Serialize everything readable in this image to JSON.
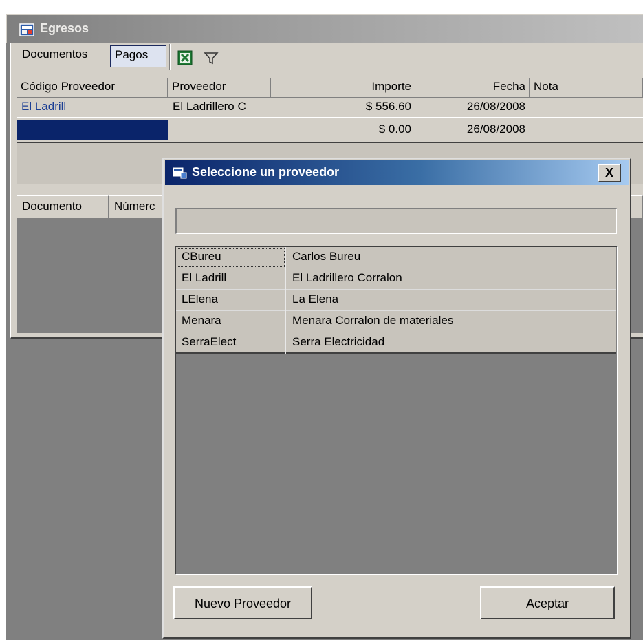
{
  "window": {
    "title": "Egresos"
  },
  "toolbar": {
    "tabs": [
      "Documentos",
      "Pagos"
    ],
    "active_tab": "Pagos",
    "icons": [
      "excel-export-icon",
      "filter-icon"
    ]
  },
  "payments_grid": {
    "columns": [
      "Código Proveedor",
      "Proveedor",
      "Importe",
      "Fecha",
      "Nota"
    ],
    "rows": [
      {
        "codigo": "El Ladrill",
        "proveedor": "El Ladrillero C",
        "importe": "$ 556.60",
        "fecha": "26/08/2008",
        "nota": ""
      },
      {
        "codigo": "",
        "proveedor": "",
        "importe": "$ 0.00",
        "fecha": "26/08/2008",
        "nota": ""
      }
    ]
  },
  "documents_grid": {
    "columns": [
      "Documento",
      "Númerc"
    ]
  },
  "dialog": {
    "title": "Seleccione un proveedor",
    "close_label": "X",
    "search_value": "",
    "suppliers": [
      {
        "code": "CBureu",
        "name": "Carlos Bureu"
      },
      {
        "code": "El Ladrill",
        "name": "El Ladrillero Corralon"
      },
      {
        "code": "LElena",
        "name": "La Elena"
      },
      {
        "code": "Menara",
        "name": "Menara Corralon de materiales"
      },
      {
        "code": "SerraElect",
        "name": "Serra Electricidad"
      }
    ],
    "buttons": {
      "new_supplier": "Nuevo Proveedor",
      "accept": "Aceptar"
    }
  },
  "colors": {
    "selection_blue": "#0a246a",
    "link_text": "#1c3f94",
    "window_face": "#d4d0c8"
  }
}
